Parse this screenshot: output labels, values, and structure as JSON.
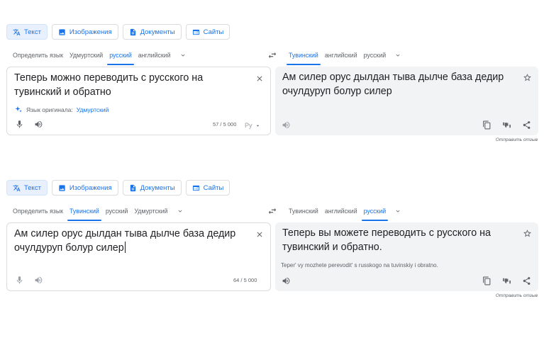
{
  "modes": {
    "text": "Текст",
    "images": "Изображения",
    "documents": "Документы",
    "sites": "Сайты"
  },
  "panels": [
    {
      "source_langs": [
        "Определить язык",
        "Удмуртский",
        "русский",
        "английский"
      ],
      "source_active": 2,
      "target_langs": [
        "Тувинский",
        "английский",
        "русский"
      ],
      "target_active": 0,
      "source_text": "Теперь можно переводить с русского на тувинский и обратно",
      "detected_prefix": "Язык оригинала:",
      "detected_lang": "Удмуртский",
      "char_count": "57 / 5 000",
      "keyboard_label": "Ру",
      "target_text": "Ам силер орус дылдан тыва дылче база дедир очулдуруп болур силер",
      "transliteration": "",
      "feedback": "Отправить отзыв"
    },
    {
      "source_langs": [
        "Определить язык",
        "Тувинский",
        "русский",
        "Удмуртский"
      ],
      "source_active": 1,
      "target_langs": [
        "Тувинский",
        "английский",
        "русский"
      ],
      "target_active": 2,
      "source_text": "Ам силер орус дылдан тыва дылче база дедир очулдуруп болур силер",
      "detected_prefix": "",
      "detected_lang": "",
      "char_count": "64 / 5 000",
      "keyboard_label": "",
      "target_text": "Теперь вы можете переводить с русского на тувинский и обратно.",
      "transliteration": "Teper' vy mozhete perevodit' s russkogo na tuvinskiy i obratno.",
      "feedback": "Отправить отзыв"
    }
  ],
  "colors": {
    "accent": "#1a73e8",
    "muted": "#5f6368",
    "target_bg": "#f1f3f4"
  }
}
